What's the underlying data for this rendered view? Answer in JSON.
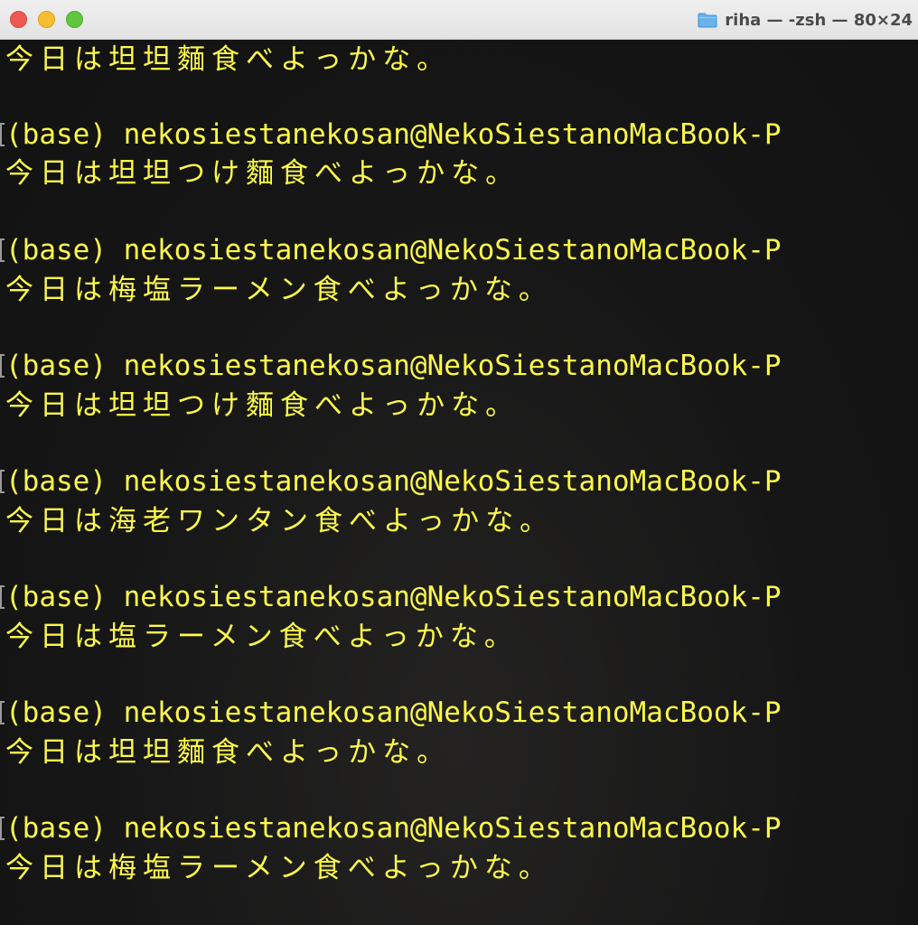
{
  "window": {
    "title": "riha — -zsh — 80×24",
    "title_icon": "folder-icon",
    "accent_text_color": "#fdf94a",
    "background_color": "#171717"
  },
  "terminal": {
    "lines": [
      {
        "kind": "output",
        "text": "今日は坦坦麵食べよっかな。"
      },
      {
        "kind": "prompt",
        "text": "(base) nekosiestanekosan@NekoSiestanoMacBook-P"
      },
      {
        "kind": "output",
        "text": "今日は坦坦つけ麵食べよっかな。"
      },
      {
        "kind": "prompt",
        "text": "(base) nekosiestanekosan@NekoSiestanoMacBook-P"
      },
      {
        "kind": "output",
        "text": "今日は梅塩ラーメン食べよっかな。"
      },
      {
        "kind": "prompt",
        "text": "(base) nekosiestanekosan@NekoSiestanoMacBook-P"
      },
      {
        "kind": "output",
        "text": "今日は坦坦つけ麵食べよっかな。"
      },
      {
        "kind": "prompt",
        "text": "(base) nekosiestanekosan@NekoSiestanoMacBook-P"
      },
      {
        "kind": "output",
        "text": "今日は海老ワンタン食べよっかな。"
      },
      {
        "kind": "prompt",
        "text": "(base) nekosiestanekosan@NekoSiestanoMacBook-P"
      },
      {
        "kind": "output",
        "text": "今日は塩ラーメン食べよっかな。"
      },
      {
        "kind": "prompt",
        "text": "(base) nekosiestanekosan@NekoSiestanoMacBook-P"
      },
      {
        "kind": "output",
        "text": "今日は坦坦麵食べよっかな。"
      },
      {
        "kind": "prompt",
        "text": "(base) nekosiestanekosan@NekoSiestanoMacBook-P"
      },
      {
        "kind": "output",
        "text": "今日は梅塩ラーメン食べよっかな。"
      }
    ]
  }
}
